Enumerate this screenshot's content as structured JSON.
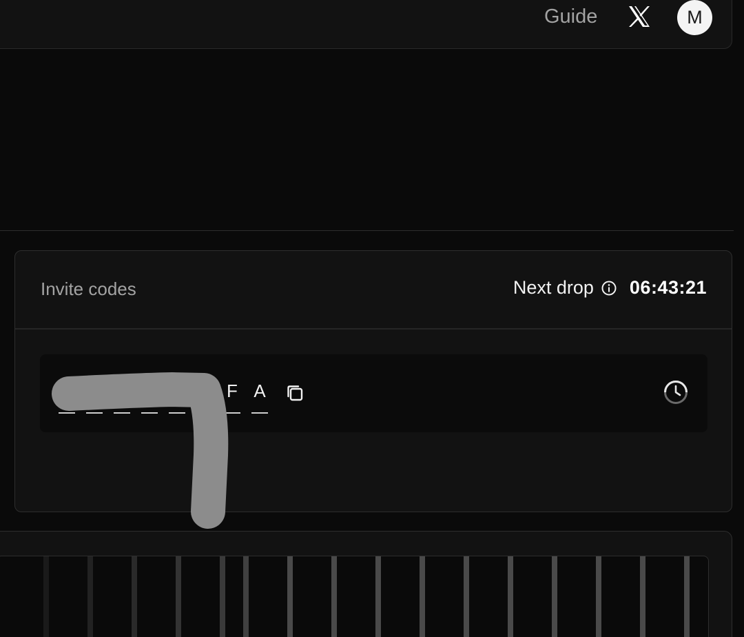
{
  "nav": {
    "guide_label": "Guide",
    "x_icon": "x-logo-icon",
    "avatar_initial": "M"
  },
  "invite": {
    "title": "Invite codes",
    "next_drop_label": "Next drop",
    "info_icon": "info-icon",
    "countdown": "06:43:21",
    "code_visible_chars": [
      "F",
      "A"
    ],
    "copy_icon": "copy-icon",
    "history_icon": "clock-history-icon"
  },
  "colors": {
    "background": "#0a0a0a",
    "card": "#121212",
    "border": "#2e2e2e",
    "muted_text": "#a3a3a3",
    "text": "#ffffff",
    "scribble": "#8c8c8c"
  }
}
